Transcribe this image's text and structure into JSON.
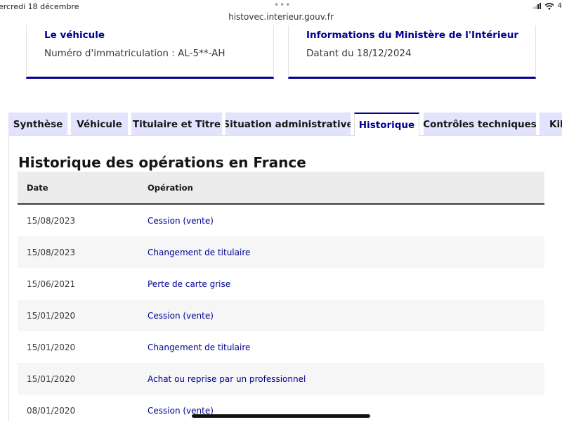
{
  "status_bar": {
    "date": "ercredi 18 décembre",
    "dots": "•••",
    "url": "histovec.interieur.gouv.fr",
    "battery": "4"
  },
  "cards": {
    "vehicle": {
      "title": "Le véhicule",
      "text": "Numéro d'immatriculation : AL-5**-AH"
    },
    "ministry": {
      "title": "Informations du Ministère de l'Intérieur",
      "text": "Datant du 18/12/2024"
    }
  },
  "tabs": [
    {
      "label": "Synthèse"
    },
    {
      "label": "Véhicule"
    },
    {
      "label": "Titulaire et Titre"
    },
    {
      "label": "Situation administrative"
    },
    {
      "label": "Historique"
    },
    {
      "label": "Contrôles techniques"
    },
    {
      "label": "Kilo"
    }
  ],
  "active_tab": "Historique",
  "history": {
    "title": "Historique des opérations en France",
    "headers": {
      "date": "Date",
      "operation": "Opération"
    },
    "rows": [
      {
        "date": "15/08/2023",
        "operation": "Cession (vente)"
      },
      {
        "date": "15/08/2023",
        "operation": "Changement de titulaire"
      },
      {
        "date": "15/06/2021",
        "operation": "Perte de carte grise"
      },
      {
        "date": "15/01/2020",
        "operation": "Cession (vente)"
      },
      {
        "date": "15/01/2020",
        "operation": "Changement de titulaire"
      },
      {
        "date": "15/01/2020",
        "operation": "Achat ou reprise par un professionnel"
      },
      {
        "date": "08/01/2020",
        "operation": "Cession (vente)"
      }
    ]
  },
  "colors": {
    "accent": "#000091",
    "tab_bg": "#e3e3fd",
    "row_alt": "#f6f6f6",
    "header_bg": "#ececec"
  },
  "icons": [
    "signal-icon",
    "wifi-icon",
    "battery-icon"
  ]
}
